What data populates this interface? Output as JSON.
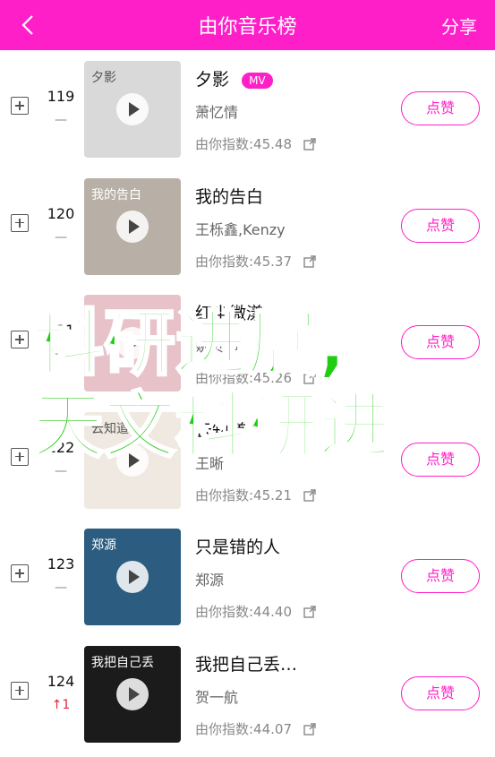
{
  "header": {
    "title": "由你音乐榜",
    "share": "分享"
  },
  "songs": [
    {
      "rank": "119",
      "trend": "—",
      "trend_up": false,
      "name": "夕影",
      "mv": "MV",
      "artist": "萧忆情",
      "index": "由你指数:45.48",
      "like": "点赞",
      "cover_color": "#d9d9d9",
      "cover_text": "夕影"
    },
    {
      "rank": "120",
      "trend": "—",
      "trend_up": false,
      "name": "我的告白",
      "mv": "",
      "artist": "王栎鑫,Kenzy",
      "index": "由你指数:45.37",
      "like": "点赞",
      "cover_color": "#b8b0a6",
      "cover_text": "我的告白"
    },
    {
      "rank": "121",
      "trend": "—",
      "trend_up": false,
      "name": "红尘微漾",
      "mv": "",
      "artist": "姚贝娜",
      "index": "由你指数:45.26",
      "like": "点赞",
      "cover_color": "#e7c2c9",
      "cover_text": ""
    },
    {
      "rank": "122",
      "trend": "—",
      "trend_up": false,
      "name": "云知道",
      "mv": "",
      "artist": "王晰",
      "index": "由你指数:45.21",
      "like": "点赞",
      "cover_color": "#efe9e2",
      "cover_text": "云知道"
    },
    {
      "rank": "123",
      "trend": "—",
      "trend_up": false,
      "name": "只是错的人",
      "mv": "",
      "artist": "郑源",
      "index": "由你指数:44.40",
      "like": "点赞",
      "cover_color": "#2c5d80",
      "cover_text": "郑源"
    },
    {
      "rank": "124",
      "trend": "↑1",
      "trend_up": true,
      "name": "我把自己丢…",
      "mv": "",
      "artist": "贺一航",
      "index": "由你指数:44.07",
      "like": "点赞",
      "cover_color": "#1b1b1b",
      "cover_text": "我把自己丢"
    }
  ],
  "overlay": {
    "line1": "科研进展,",
    "line2": "天文科研进"
  },
  "colors": {
    "accent": "#ff1fc8",
    "overlay": "#22cc11"
  }
}
